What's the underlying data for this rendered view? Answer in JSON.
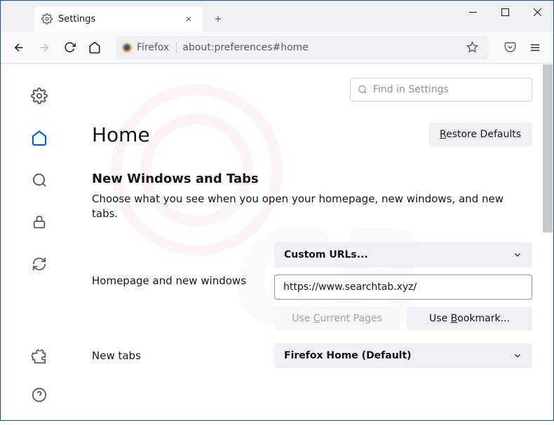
{
  "tab": {
    "title": "Settings"
  },
  "urlbar": {
    "identity": "Firefox",
    "url": "about:preferences#home"
  },
  "search": {
    "placeholder": "Find in Settings"
  },
  "page": {
    "title": "Home",
    "restore_btn": "Restore Defaults"
  },
  "section": {
    "title": "New Windows and Tabs",
    "desc": "Choose what you see when you open your homepage, new windows, and new tabs."
  },
  "homepage": {
    "label": "Homepage and new windows",
    "select": "Custom URLs...",
    "url": "https://www.searchtab.xyz/",
    "use_current": "Use Current Pages",
    "use_bookmark": "Use Bookmark..."
  },
  "newtabs": {
    "label": "New tabs",
    "select": "Firefox Home (Default)"
  }
}
